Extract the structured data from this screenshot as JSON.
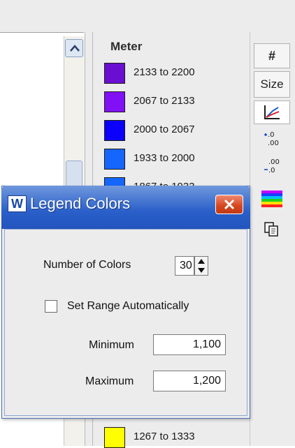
{
  "legend": {
    "title": "Meter",
    "items": [
      {
        "label": "2133 to 2200",
        "color": "#6a0fd2"
      },
      {
        "label": "2067 to 2133",
        "color": "#8210f5"
      },
      {
        "label": "2000 to 2067",
        "color": "#0a00fb"
      },
      {
        "label": "1933 to 2000",
        "color": "#1466ff"
      },
      {
        "label": "1867 to 1933",
        "color": "#1466ff"
      },
      {
        "label": "1267 to 1333",
        "color": "#ffff00"
      }
    ]
  },
  "toolbar": {
    "hash_label": "#",
    "size_label": "Size",
    "inc_decimal_icon": "increase-decimal-icon",
    "dec_decimal_icon": "decrease-decimal-icon"
  },
  "dialog": {
    "app_icon_letter": "W",
    "title": "Legend Colors",
    "number_of_colors_label": "Number of Colors",
    "number_of_colors_value": "30",
    "set_range_label": "Set Range Automatically",
    "set_range_checked": false,
    "minimum_label": "Minimum",
    "minimum_value": "1,100",
    "maximum_label": "Maximum",
    "maximum_value": "1,200"
  }
}
